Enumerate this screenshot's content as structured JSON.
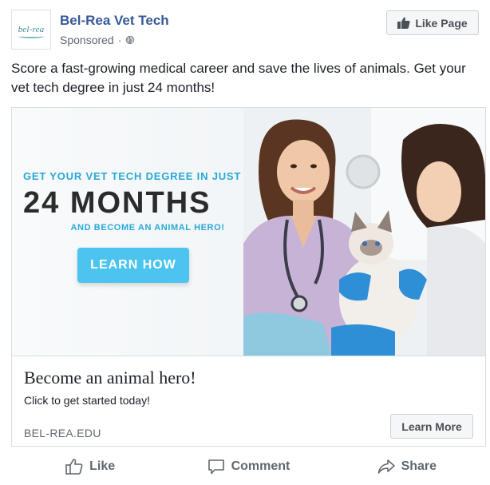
{
  "page": {
    "name": "Bel-Rea Vet Tech",
    "logo_text": "bel-rea",
    "sponsored": "Sponsored",
    "separator": "·",
    "like_page_label": "Like Page"
  },
  "post": {
    "text": "Score a fast-growing medical career and save the lives of animals. Get your vet tech degree in just 24 months!"
  },
  "ad": {
    "image": {
      "headline_top": "GET YOUR VET TECH DEGREE IN JUST",
      "headline_big": "24 MONTHS",
      "headline_sub": "AND BECOME AN ANIMAL HERO!",
      "button_label": "LEARN HOW"
    },
    "title": "Become an animal hero!",
    "description": "Click to get started today!",
    "domain": "BEL-REA.EDU",
    "cta_label": "Learn More"
  },
  "actions": {
    "like": "Like",
    "comment": "Comment",
    "share": "Share"
  },
  "colors": {
    "page_name": "#365899",
    "accent_blue": "#4cc4ef",
    "headline_blue": "#2aa8d8",
    "muted_text": "#606770"
  }
}
